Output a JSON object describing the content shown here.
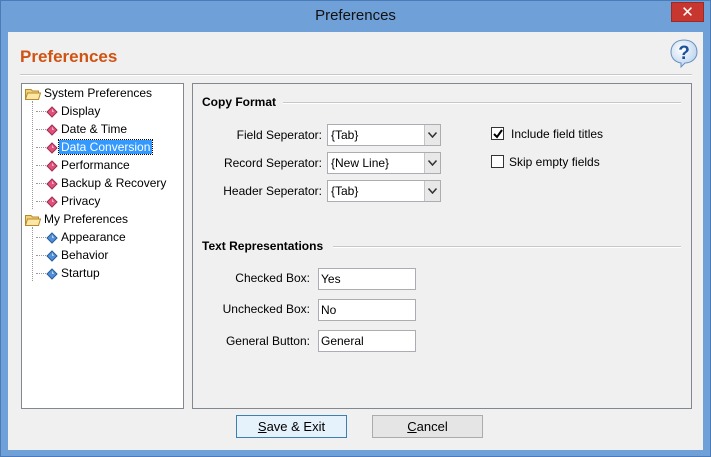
{
  "window": {
    "title": "Preferences",
    "close_glyph": "✕"
  },
  "header": {
    "title": "Preferences",
    "help_icon": "help-question-icon",
    "accent_color": "#d05313"
  },
  "tree": {
    "groups": [
      {
        "label": "System Preferences",
        "items": [
          "Display",
          "Date & Time",
          "Data Conversion",
          "Performance",
          "Backup & Recovery",
          "Privacy"
        ]
      },
      {
        "label": "My Preferences",
        "items": [
          "Appearance",
          "Behavior",
          "Startup"
        ]
      }
    ],
    "selected": "Data Conversion"
  },
  "copy_format": {
    "title": "Copy Format",
    "field_sep_label": "Field Seperator:",
    "field_sep_value": "{Tab}",
    "record_sep_label": "Record Seperator:",
    "record_sep_value": "{New Line}",
    "header_sep_label": "Header Seperator:",
    "header_sep_value": "{Tab}",
    "include_titles_label": "Include field titles",
    "include_titles_checked": true,
    "skip_empty_label": "Skip empty fields",
    "skip_empty_checked": false
  },
  "text_repr": {
    "title": "Text Representations",
    "checked_label": "Checked Box:",
    "checked_value": "Yes",
    "unchecked_label": "Unchecked Box:",
    "unchecked_value": "No",
    "general_label": "General Button:",
    "general_value": "General"
  },
  "buttons": {
    "save_prefix": "",
    "save_hotkey": "S",
    "save_rest": "ave & Exit",
    "cancel_hotkey": "C",
    "cancel_rest": "ancel"
  }
}
